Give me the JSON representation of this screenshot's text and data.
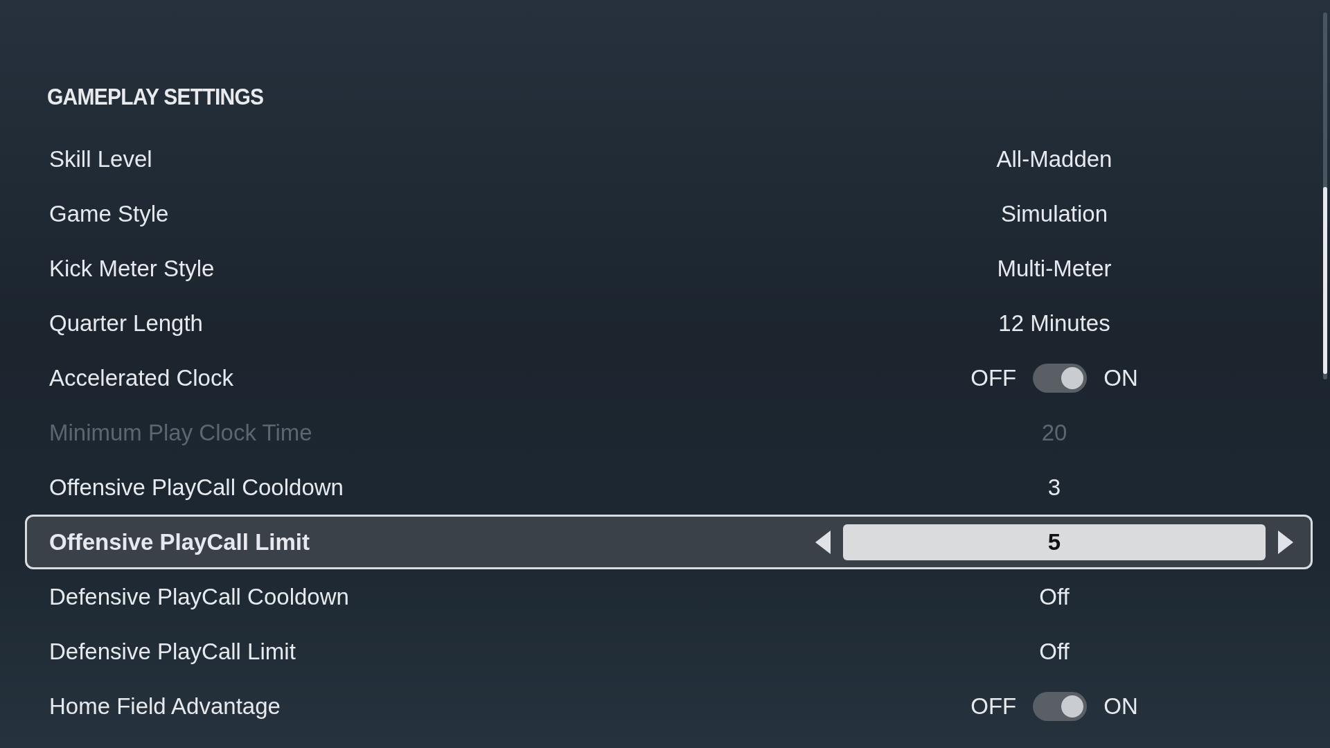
{
  "section_title": "GAMEPLAY SETTINGS",
  "settings": [
    {
      "kind": "value",
      "label": "Skill Level",
      "value": "All-Madden",
      "disabled": false,
      "selected": false
    },
    {
      "kind": "value",
      "label": "Game Style",
      "value": "Simulation",
      "disabled": false,
      "selected": false
    },
    {
      "kind": "value",
      "label": "Kick Meter Style",
      "value": "Multi-Meter",
      "disabled": false,
      "selected": false
    },
    {
      "kind": "value",
      "label": "Quarter Length",
      "value": "12 Minutes",
      "disabled": false,
      "selected": false
    },
    {
      "kind": "toggle",
      "label": "Accelerated Clock",
      "off_label": "OFF",
      "on_label": "ON",
      "on": true,
      "disabled": false,
      "selected": false
    },
    {
      "kind": "value",
      "label": "Minimum Play Clock Time",
      "value": "20",
      "disabled": true,
      "selected": false
    },
    {
      "kind": "value",
      "label": "Offensive PlayCall Cooldown",
      "value": "3",
      "disabled": false,
      "selected": false
    },
    {
      "kind": "stepper",
      "label": "Offensive PlayCall Limit",
      "value": "5",
      "disabled": false,
      "selected": true
    },
    {
      "kind": "value",
      "label": "Defensive PlayCall Cooldown",
      "value": "Off",
      "disabled": false,
      "selected": false
    },
    {
      "kind": "value",
      "label": "Defensive PlayCall Limit",
      "value": "Off",
      "disabled": false,
      "selected": false
    },
    {
      "kind": "toggle",
      "label": "Home Field Advantage",
      "off_label": "OFF",
      "on_label": "ON",
      "on": true,
      "disabled": false,
      "selected": false
    }
  ]
}
